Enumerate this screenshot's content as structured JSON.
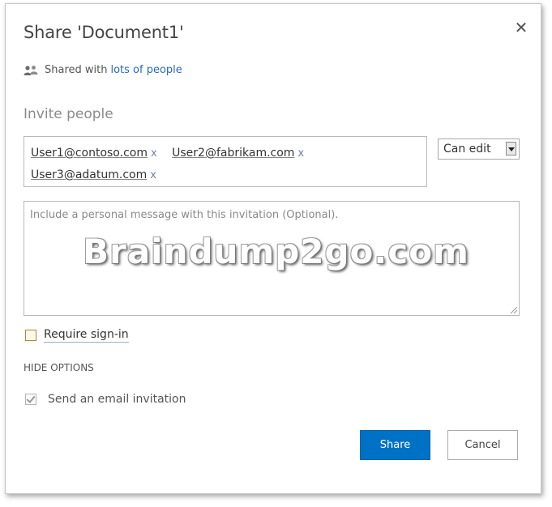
{
  "dialog": {
    "title": "Share 'Document1'",
    "close_icon": "close-icon",
    "shared_prefix": "Shared with",
    "shared_link": "lots of people",
    "people_icon": "people-icon",
    "invite_title": "Invite people",
    "recipients": [
      {
        "name": "User1@contoso.com",
        "remove": "x"
      },
      {
        "name": "User2@fabrikam.com",
        "remove": "x"
      },
      {
        "name": "User3@adatum.com",
        "remove": "x"
      }
    ],
    "permission": "Can edit",
    "message_placeholder": "Include a personal message with this invitation (Optional).",
    "watermark": "Braindump2go.com",
    "require_signin_label": "Require sign-in",
    "require_signin_checked": false,
    "hide_options_label": "HIDE OPTIONS",
    "send_email_label": "Send an email invitation",
    "send_email_checked": true,
    "share_button": "Share",
    "cancel_button": "Cancel"
  },
  "colors": {
    "primary": "#0072c6",
    "link": "#2a6ab6"
  }
}
